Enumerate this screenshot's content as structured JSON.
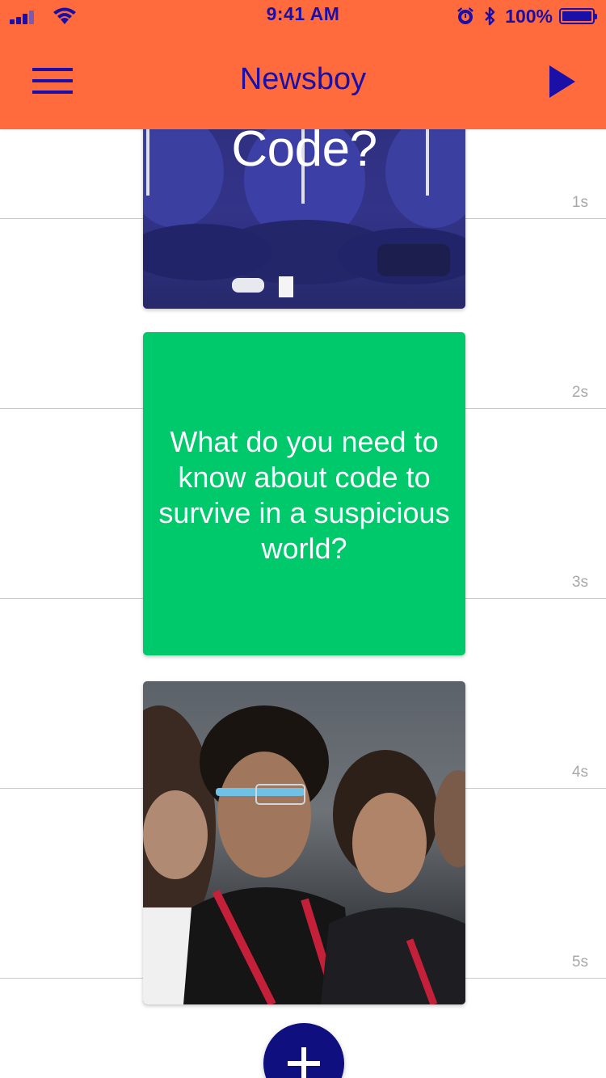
{
  "status_bar": {
    "time": "9:41 AM",
    "battery_percent": "100%",
    "battery_level": 1.0
  },
  "nav": {
    "title": "Newsboy",
    "menu_icon": "hamburger-icon",
    "play_icon": "play-icon"
  },
  "timeline": {
    "ticks": [
      "1s",
      "2s",
      "3s",
      "4s",
      "5s"
    ]
  },
  "cards": [
    {
      "type": "image",
      "caption": "What is Code?",
      "image": "conference-audience-photo"
    },
    {
      "type": "text",
      "text": "What do you need to know about code to survive in a suspicious world?",
      "color": "#00c96b"
    },
    {
      "type": "image",
      "image": "audience-with-smart-glasses-photo"
    }
  ],
  "fab": {
    "icon": "plus-icon"
  },
  "colors": {
    "header": "#ff6b3d",
    "accent": "#1a10a8",
    "fab": "#0f0f80",
    "text_card": "#00c96b"
  }
}
